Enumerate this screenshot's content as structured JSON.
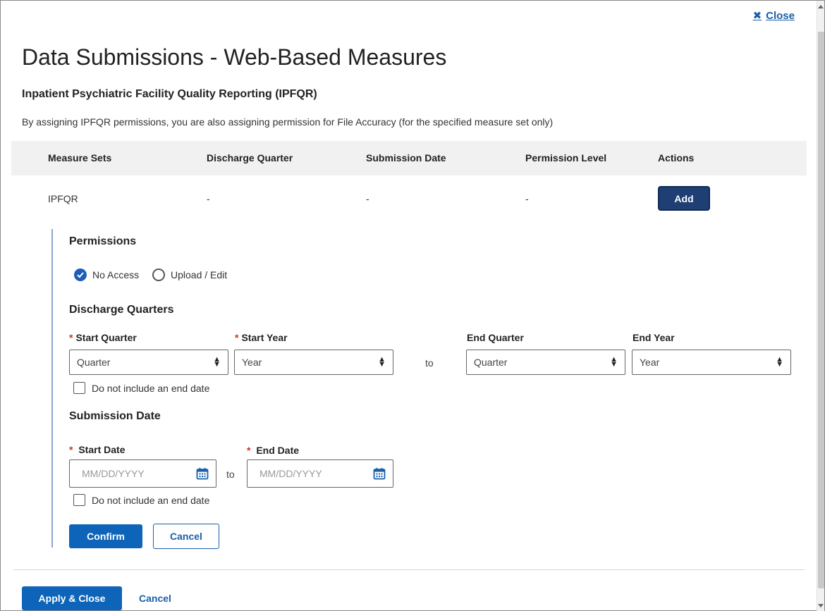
{
  "dialog": {
    "close_label": "Close",
    "title": "Data Submissions - Web-Based Measures",
    "program_title": "Inpatient Psychiatric Facility Quality Reporting (IPFQR)",
    "info_text": "By assigning IPFQR permissions, you are also assigning permission for File Accuracy (for the specified measure set only)"
  },
  "table": {
    "headers": [
      "Measure Sets",
      "Discharge Quarter",
      "Submission Date",
      "Permission Level",
      "Actions"
    ],
    "rows": [
      {
        "measure_set": "IPFQR",
        "discharge_quarter": "-",
        "submission_date": "-",
        "permission_level": "-",
        "action_label": "Add"
      }
    ]
  },
  "form": {
    "permissions_heading": "Permissions",
    "permission_options": [
      {
        "label": "No Access",
        "selected": true
      },
      {
        "label": "Upload / Edit",
        "selected": false
      }
    ],
    "discharge_heading": "Discharge Quarters",
    "start_quarter_label": "Start Quarter",
    "start_quarter_value": "Quarter",
    "start_year_label": "Start Year",
    "start_year_value": "Year",
    "to_label": "to",
    "end_quarter_label": "End Quarter",
    "end_quarter_value": "Quarter",
    "end_year_label": "End Year",
    "end_year_value": "Year",
    "no_end_date_label": "Do not include an end date",
    "submission_heading": "Submission Date",
    "start_date_label": "Start Date",
    "start_date_placeholder": "MM/DD/YYYY",
    "end_date_label": "End Date",
    "end_date_placeholder": "MM/DD/YYYY",
    "confirm_label": "Confirm",
    "cancel_label": "Cancel",
    "required_marker": "*"
  },
  "footer": {
    "apply_label": "Apply & Close",
    "cancel_label": "Cancel"
  },
  "colors": {
    "primary": "#0d64b8",
    "navy": "#1e3e74",
    "link": "#1a5fa8",
    "required": "#c0392b"
  }
}
